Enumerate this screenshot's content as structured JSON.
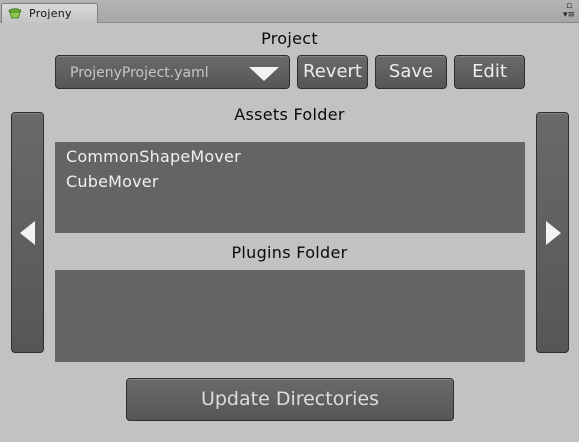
{
  "window": {
    "tab_title": "Projeny",
    "tab_icon": "projeny-logo-icon",
    "controls": [
      "maximize-icon",
      "menu-icon"
    ]
  },
  "project": {
    "section_title": "Project",
    "selected_file": "ProjenyProject.yaml",
    "buttons": {
      "revert": "Revert",
      "save": "Save",
      "edit": "Edit"
    }
  },
  "assets": {
    "section_title": "Assets Folder",
    "items": [
      {
        "label": "CommonShapeMover"
      },
      {
        "label": "CubeMover"
      }
    ]
  },
  "plugins": {
    "section_title": "Plugins Folder",
    "items": []
  },
  "navigation": {
    "left_icon": "arrow-left-icon",
    "right_icon": "arrow-right-icon"
  },
  "actions": {
    "update_label": "Update Directories"
  },
  "colors": {
    "background": "#c2c2c2",
    "button": "#5f5f5f",
    "panel": "#646464",
    "text_light": "#f0f0f0"
  }
}
